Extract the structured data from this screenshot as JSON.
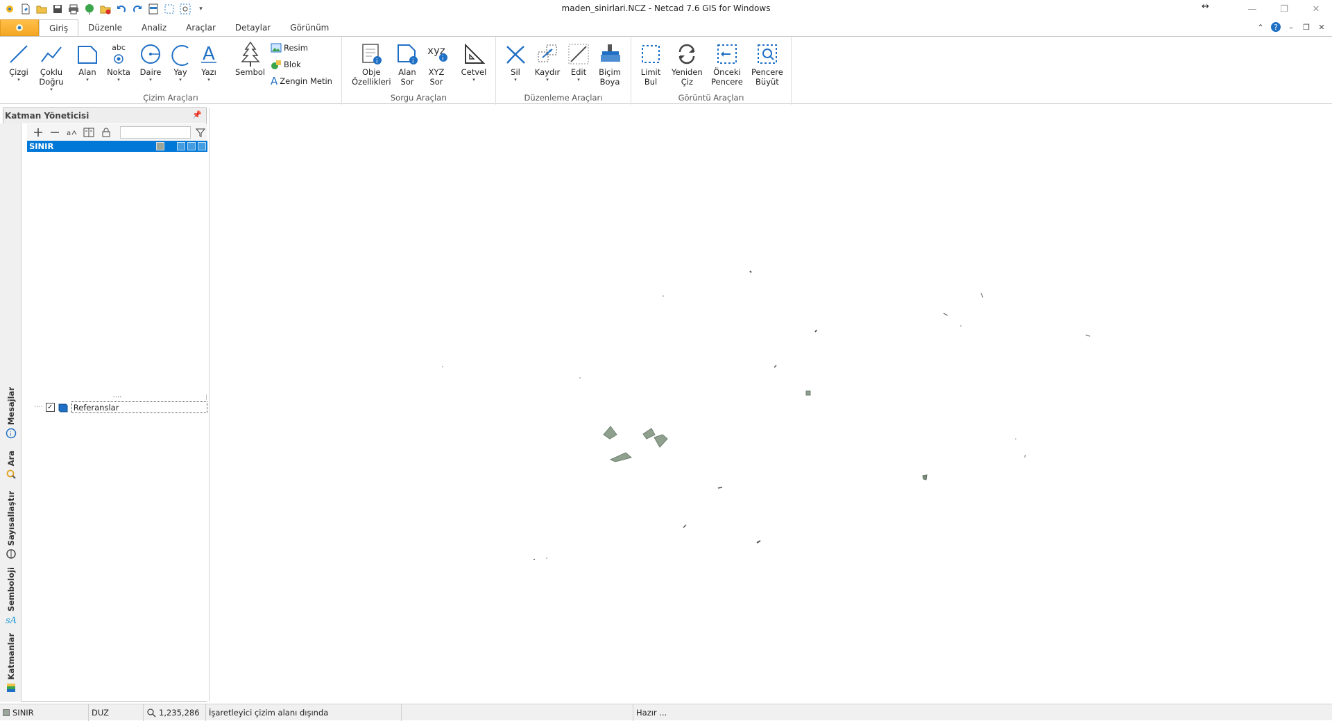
{
  "window": {
    "title": "maden_sinirlari.NCZ - Netcad 7.6 GIS for Windows",
    "resize_indicator": "↔"
  },
  "quick_access": [
    "app-icon",
    "new-file-icon",
    "open-folder-icon",
    "save-icon",
    "print-icon",
    "globe-icon",
    "close-file-icon",
    "undo-icon",
    "redo-icon",
    "layout-icon",
    "select-icon",
    "zoom-window-icon",
    "customize-icon"
  ],
  "tabs": {
    "app_button": "app-menu-icon",
    "items": [
      "Giriş",
      "Düzenle",
      "Analiz",
      "Araçlar",
      "Detaylar",
      "Görünüm"
    ]
  },
  "ribbon": {
    "groups": {
      "cizim": "Çizim Araçları",
      "sorgu": "Sorgu Araçları",
      "duzenleme": "Düzenleme Araçları",
      "goruntu": "Görüntü Araçları"
    },
    "buttons": {
      "cizgi": "Çizgi",
      "coklu_dogru_1": "Çoklu",
      "coklu_dogru_2": "Doğru",
      "alan": "Alan",
      "nokta": "Nokta",
      "nokta_abc": "abc",
      "daire": "Daire",
      "yay": "Yay",
      "yazi": "Yazı",
      "sembol": "Sembol",
      "resim": "Resim",
      "blok": "Blok",
      "zengin_metin": "Zengin Metin",
      "obje_1": "Obje",
      "obje_2": "Özellikleri",
      "alan_sor_1": "Alan",
      "alan_sor_2": "Sor",
      "xyz_top": "xyz",
      "xyz_1": "XYZ",
      "xyz_2": "Sor",
      "cetvel": "Cetvel",
      "sil": "Sil",
      "kaydir": "Kaydır",
      "edit": "Edit",
      "bicim_1": "Biçim",
      "bicim_2": "Boya",
      "limit_1": "Limit",
      "limit_2": "Bul",
      "yeniden_1": "Yeniden",
      "yeniden_2": "Çiz",
      "onceki_1": "Önceki",
      "onceki_2": "Pencere",
      "pencere_1": "Pencere",
      "pencere_2": "Büyüt"
    }
  },
  "side_tabs": [
    "Mesajlar",
    "Ara",
    "Sayısallaştır",
    "Semboloji",
    "Katmanlar"
  ],
  "layer_panel": {
    "title": "Katman Yöneticisi",
    "filter_value": "",
    "layers": [
      {
        "name": "SINIR",
        "color": "#9aa69a",
        "selected": true
      }
    ],
    "splitter": "....",
    "references": [
      {
        "label": "Referanslar",
        "checked": true
      }
    ]
  },
  "status_bar": {
    "layer": "SINIR",
    "mode": "DUZ",
    "scale": "1,235,286",
    "pointer_message": "İşaretleyici çizim alanı dışında",
    "extra": "",
    "state": "Hazır ..."
  },
  "colors": {
    "selection": "#0078d7",
    "app_button": "#f5a623",
    "polygon_fill": "#8fa08f",
    "polygon_stroke": "#6f7f6f"
  }
}
